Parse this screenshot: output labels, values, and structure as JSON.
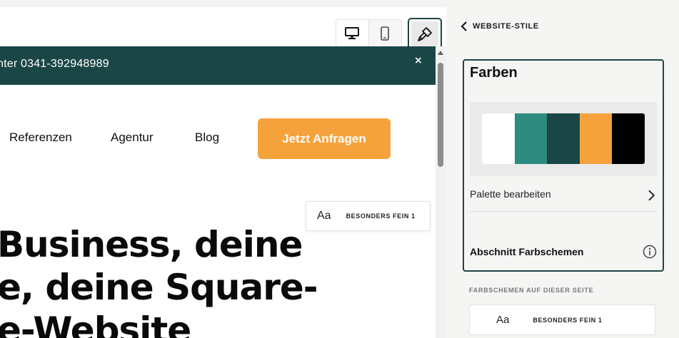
{
  "toolbar": {
    "desktop_icon": "desktop-monitor-icon",
    "mobile_icon": "mobile-phone-icon",
    "style_icon": "paintbrush-icon"
  },
  "site": {
    "announcement": {
      "text": "nter 0341-392948989",
      "close": "×",
      "background": "#1b4646"
    },
    "nav": {
      "items": [
        "Referenzen",
        "Agentur",
        "Blog"
      ],
      "cta_label": "Jetzt Anfragen",
      "cta_color": "#f6a23c"
    },
    "font_tag": {
      "sample": "Aa",
      "name": "BESONDERS FEIN 1"
    },
    "hero_lines": [
      "Business, deine",
      "e, deine Square-",
      "e-Website"
    ]
  },
  "panel": {
    "back_label": "WEBSITE-STILE",
    "colors": {
      "title": "Farben",
      "swatches": [
        "#ffffff",
        "#2e8b80",
        "#1b4646",
        "#f6a23c",
        "#000000"
      ],
      "edit_palette_label": "Palette bearbeiten",
      "section_schemes_label": "Abschnitt Farbschemen"
    },
    "page_schemes_heading": "FARBSCHEMEN AUF DIESER SEITE",
    "scheme_card": {
      "sample": "Aa",
      "name": "BESONDERS FEIN 1"
    },
    "accent_border": "#1d4444"
  }
}
